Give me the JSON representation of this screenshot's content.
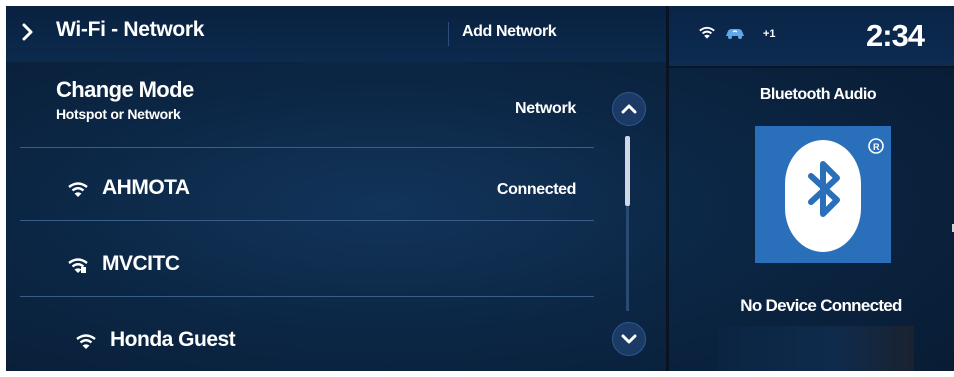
{
  "header": {
    "title": "Wi-Fi - Network",
    "add_network_label": "Add Network"
  },
  "mode": {
    "title": "Change Mode",
    "subtitle": "Hotspot or Network",
    "value": "Network"
  },
  "networks": [
    {
      "name": "AHMOTA",
      "status": "Connected",
      "icon": "wifi-icon"
    },
    {
      "name": "MVCITC",
      "status": "",
      "icon": "wifi-signal-icon"
    },
    {
      "name": "Honda Guest",
      "status": "",
      "icon": "wifi-icon"
    }
  ],
  "status_bar": {
    "extra_count": "+1",
    "clock": "2:34"
  },
  "bluetooth": {
    "title": "Bluetooth Audio",
    "status": "No Device Connected"
  },
  "colors": {
    "background": "#0b2644",
    "bluetooth_tile": "#2a6fb9",
    "text": "#ffffff"
  }
}
